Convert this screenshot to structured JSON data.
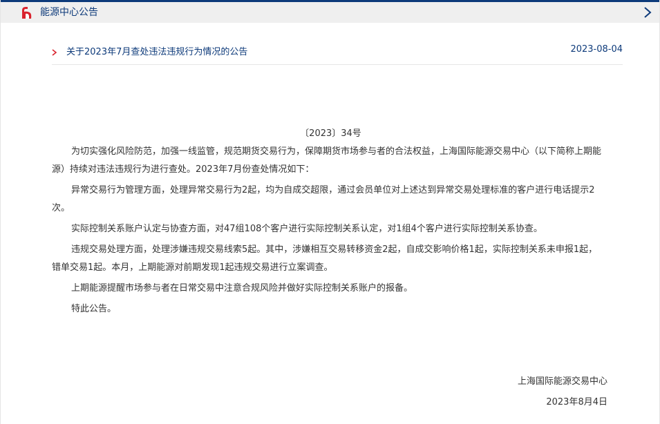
{
  "header": {
    "title": "能源中心公告",
    "logo_icon": "shfe-logo-icon",
    "more_icon": "chevron-right-icon",
    "accent_color": "#0d3a7a",
    "logo_color": "#d9232e"
  },
  "article": {
    "title": "关于2023年7月查处违法违规行为情况的公告",
    "date": "2023-08-04"
  },
  "notice": {
    "doc_number": "〔2023〕34号",
    "paragraphs": [
      "为切实强化风险防范，加强一线监管，规范期货交易行为，保障期货市场参与者的合法权益，上海国际能源交易中心（以下简称上期能源）持续对违法违规行为进行查处。2023年7月份查处情况如下：",
      "异常交易行为管理方面，处理异常交易行为2起，均为自成交超限，通过会员单位对上述达到异常交易处理标准的客户进行电话提示2次。",
      "实际控制关系账户认定与协查方面，对47组108个客户进行实际控制关系认定，对1组4个客户进行实际控制关系协查。",
      "违规交易处理方面，处理涉嫌违规交易线索5起。其中，涉嫌相互交易转移资金2起，自成交影响价格1起，实际控制关系未申报1起，错单交易1起。本月，上期能源对前期发现1起违规交易进行立案调查。",
      "上期能源提醒市场参与者在日常交易中注意合规风险并做好实际控制关系账户的报备。",
      "特此公告。"
    ],
    "signature_org": "上海国际能源交易中心",
    "signature_date": "2023年8月4日"
  }
}
